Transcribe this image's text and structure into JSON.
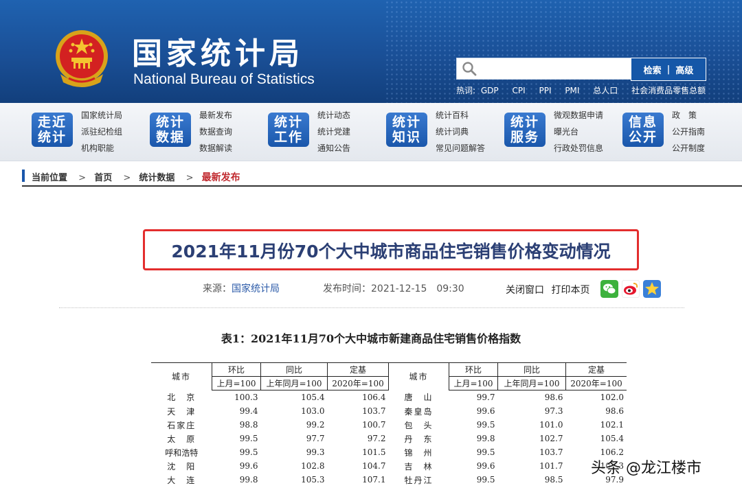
{
  "header": {
    "site_name_cn": "国家统计局",
    "site_name_en": "National Bureau of Statistics",
    "search": {
      "placeholder": "",
      "search_label": "检索",
      "separator": "|",
      "advanced_label": "高级"
    },
    "hotwords_label": "热词:",
    "hotwords": [
      "GDP",
      "CPI",
      "PPI",
      "PMI",
      "总人口",
      "社会消费品零售总额"
    ]
  },
  "nav": [
    {
      "badge": [
        "走近",
        "统计"
      ],
      "links": [
        "国家统计局",
        "派驻纪检组",
        "机构职能"
      ]
    },
    {
      "badge": [
        "统计",
        "数据"
      ],
      "links": [
        "最新发布",
        "数据查询",
        "数据解读"
      ]
    },
    {
      "badge": [
        "统计",
        "工作"
      ],
      "links": [
        "统计动态",
        "统计党建",
        "通知公告"
      ]
    },
    {
      "badge": [
        "统计",
        "知识"
      ],
      "links": [
        "统计百科",
        "统计词典",
        "常见问题解答"
      ]
    },
    {
      "badge": [
        "统计",
        "服务"
      ],
      "links": [
        "微观数据申请",
        "曝光台",
        "行政处罚信息"
      ]
    },
    {
      "badge": [
        "信息",
        "公开"
      ],
      "links": [
        "政　策",
        "公开指南",
        "公开制度"
      ]
    }
  ],
  "breadcrumb": {
    "label": "当前位置",
    "sep": ">",
    "items": [
      "首页",
      "统计数据"
    ],
    "current": "最新发布"
  },
  "article": {
    "title": "2021年11月份70个大中城市商品住宅销售价格变动情况",
    "source_label": "来源：",
    "source": "国家统计局",
    "time_label": "发布时间：",
    "time": "2021-12-15　09:30",
    "close_label": "关闭窗口",
    "print_label": "打印本页"
  },
  "table": {
    "title": "表1：2021年11月70个大中城市新建商品住宅销售价格指数",
    "headers": {
      "city": "城市",
      "mom": "环比",
      "mom_base": "上月=100",
      "yoy": "同比",
      "yoy_base": "上年同月=100",
      "fixed": "定基",
      "fixed_base": "2020年=100"
    },
    "rows": [
      {
        "l": [
          "北　京",
          "100.3",
          "105.4",
          "106.4"
        ],
        "r": [
          "唐　山",
          "99.7",
          "98.6",
          "102.0"
        ]
      },
      {
        "l": [
          "天　津",
          "99.4",
          "103.0",
          "103.7"
        ],
        "r": [
          "秦皇岛",
          "99.6",
          "97.3",
          "98.6"
        ]
      },
      {
        "l": [
          "石家庄",
          "98.8",
          "99.2",
          "100.7"
        ],
        "r": [
          "包　头",
          "99.5",
          "101.0",
          "102.1"
        ]
      },
      {
        "l": [
          "太　原",
          "99.5",
          "97.7",
          "97.2"
        ],
        "r": [
          "丹　东",
          "99.8",
          "102.7",
          "105.4"
        ]
      },
      {
        "l": [
          "呼和浩特",
          "99.5",
          "99.3",
          "101.5"
        ],
        "r": [
          "锦　州",
          "99.5",
          "103.7",
          "106.2"
        ]
      },
      {
        "l": [
          "沈　阳",
          "99.6",
          "102.8",
          "104.7"
        ],
        "r": [
          "吉　林",
          "99.6",
          "101.7",
          "102.3"
        ]
      },
      {
        "l": [
          "大　连",
          "99.8",
          "105.3",
          "107.1"
        ],
        "r": [
          "牡丹江",
          "99.5",
          "98.5",
          "97.9"
        ]
      }
    ]
  },
  "watermark": "头条 @龙江楼市",
  "colors": {
    "header_blue": "#1a4f96",
    "title_box_red": "#e32d2d",
    "title_text": "#2b3f74",
    "crumb_current": "#c0282d"
  }
}
